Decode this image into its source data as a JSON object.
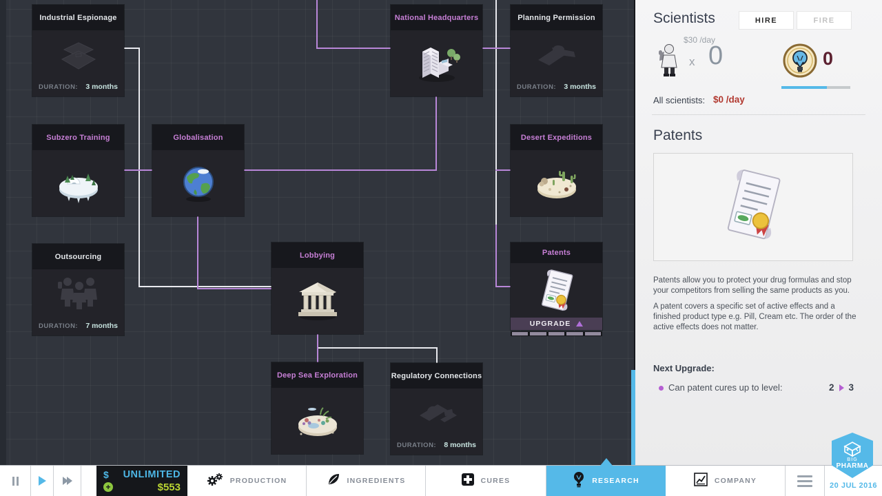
{
  "research_tree": {
    "duration_label": "DURATION:",
    "nodes": [
      {
        "title": "Industrial Espionage",
        "status": "locked",
        "duration": "3 months",
        "icon": "briefcase-icon"
      },
      {
        "title": "Subzero Training",
        "status": "researched",
        "icon": "arctic-island-icon"
      },
      {
        "title": "Outsourcing",
        "status": "locked",
        "duration": "7 months",
        "icon": "workers-icon"
      },
      {
        "title": "Globalisation",
        "status": "researched",
        "icon": "globe-icon"
      },
      {
        "title": "National Headquarters",
        "status": "researched",
        "icon": "buildings-icon"
      },
      {
        "title": "Lobbying",
        "status": "researched",
        "icon": "temple-icon"
      },
      {
        "title": "Deep Sea Exploration",
        "status": "researched",
        "icon": "reef-island-icon"
      },
      {
        "title": "Regulatory Connections",
        "status": "locked",
        "duration": "8 months",
        "icon": "stamps-icon"
      },
      {
        "title": "Planning Permission",
        "status": "locked",
        "duration": "3 months",
        "icon": "stamp-icon"
      },
      {
        "title": "Desert Expeditions",
        "status": "researched",
        "icon": "desert-island-icon"
      },
      {
        "title": "Patents",
        "status": "upgradeable",
        "action_label": "UPGRADE",
        "icon": "patent-icon"
      }
    ]
  },
  "scientists_panel": {
    "title": "Scientists",
    "hire_label": "HIRE",
    "fire_label": "FIRE",
    "cost_per_day": "$30 /day",
    "multiply_symbol": "x",
    "count": "0",
    "knowledge_count": "0",
    "all_scientists_label": "All scientists:",
    "all_scientists_cost": "$0 /day"
  },
  "patents_panel": {
    "title": "Patents",
    "description_1": "Patents allow you to protect your drug formulas and stop your competitors from selling the same products as you.",
    "description_2": "A patent covers a specific set of active effects and a finished product type e.g. Pill, Cream etc. The order of the active effects does not matter.",
    "next_upgrade_label": "Next Upgrade:",
    "upgrade_item": "Can patent cures up to level:",
    "level_from": "2",
    "level_to": "3"
  },
  "bottom_bar": {
    "dollar_symbol": "$",
    "money_unlimited": "UNLIMITED",
    "money_balance": "$553",
    "tabs": [
      {
        "label": "PRODUCTION",
        "icon": "gears-icon"
      },
      {
        "label": "INGREDIENTS",
        "icon": "leaf-icon"
      },
      {
        "label": "CURES",
        "icon": "plus-cross-icon"
      },
      {
        "label": "RESEARCH",
        "icon": "lightbulb-icon",
        "active": true
      },
      {
        "label": "COMPANY",
        "icon": "chart-icon"
      }
    ],
    "logo_line1": "BIG",
    "logo_line2": "PHARMA",
    "date": "20 JUL 2016"
  },
  "colors": {
    "accent_blue": "#55b9e8",
    "accent_purple": "#b987d9",
    "money_green": "#b9d433",
    "cost_red": "#b23a31",
    "knowledge_maroon": "#5c2130"
  }
}
